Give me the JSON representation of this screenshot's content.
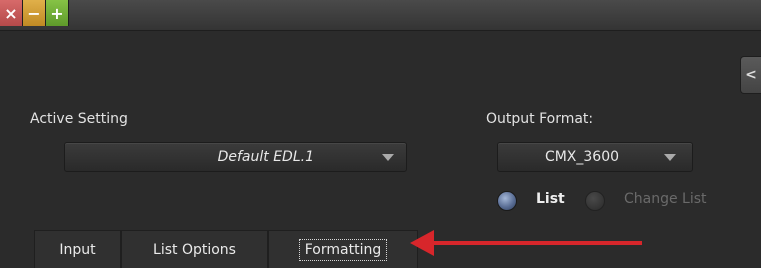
{
  "window_controls": {
    "close": "×",
    "minimize": "−",
    "maximize": "+"
  },
  "collapse_button": {
    "glyph": "<"
  },
  "active_setting": {
    "label": "Active Setting",
    "value": "Default EDL.1"
  },
  "output_format": {
    "label": "Output Format:",
    "value": "CMX_3600",
    "options": [
      {
        "label": "List",
        "selected": true
      },
      {
        "label": "Change List",
        "selected": false
      }
    ]
  },
  "tabs": [
    {
      "label": "Input",
      "active": false
    },
    {
      "label": "List Options",
      "active": false
    },
    {
      "label": "Formatting",
      "active": true
    }
  ],
  "colors": {
    "annotation_arrow": "#d7262b",
    "radio_selected": "#6a80a8",
    "disabled_text": "#6a6a6a"
  }
}
